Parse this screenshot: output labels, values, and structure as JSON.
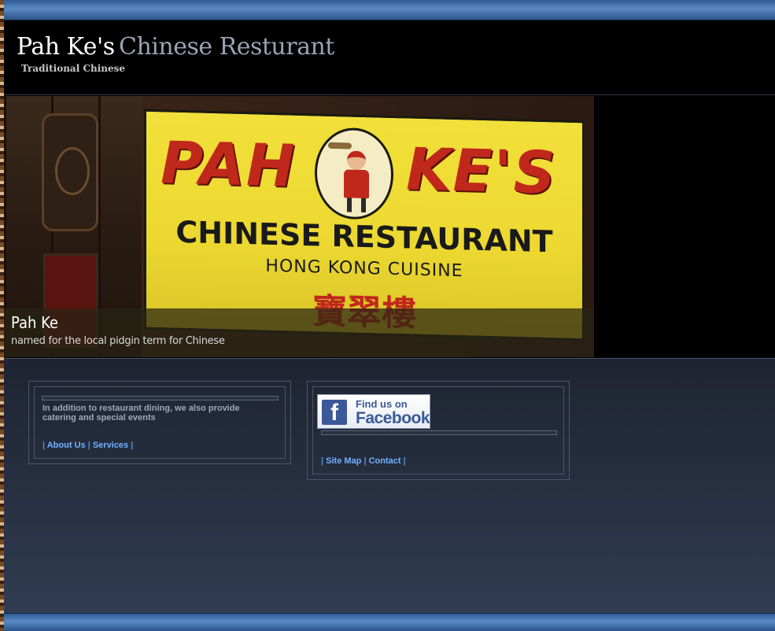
{
  "header": {
    "brand_name": "Pah Ke's",
    "brand_tagline": "Chinese Resturant",
    "brand_sub": "Traditional Chinese"
  },
  "banner": {
    "sign": {
      "word_left": "PAH",
      "word_right": "KE'S",
      "line1": "CHINESE RESTAURANT",
      "line2": "HONG KONG CUISINE",
      "chinese": "寶翠樓"
    },
    "caption_title": "Pah Ke",
    "caption_sub": "named for the local pidgin term for Chinese"
  },
  "left_box": {
    "text": "In addition to restaurant dining, we also  provide catering and special events",
    "links": {
      "sep": "|",
      "about": "About Us",
      "services": "Services"
    }
  },
  "right_box": {
    "facebook": {
      "icon_letter": "f",
      "find": "Find us on",
      "name": "Facebook"
    },
    "links": {
      "sep": "|",
      "sitemap": "Site Map",
      "contact": "Contact"
    }
  },
  "colors": {
    "bar_blue": "#5a8ac4",
    "link_blue": "#6fb2ff",
    "body_text": "#9ea8b8",
    "facebook_blue": "#3b5998",
    "sign_yellow": "#f2e03a",
    "sign_red": "#c0281c"
  }
}
